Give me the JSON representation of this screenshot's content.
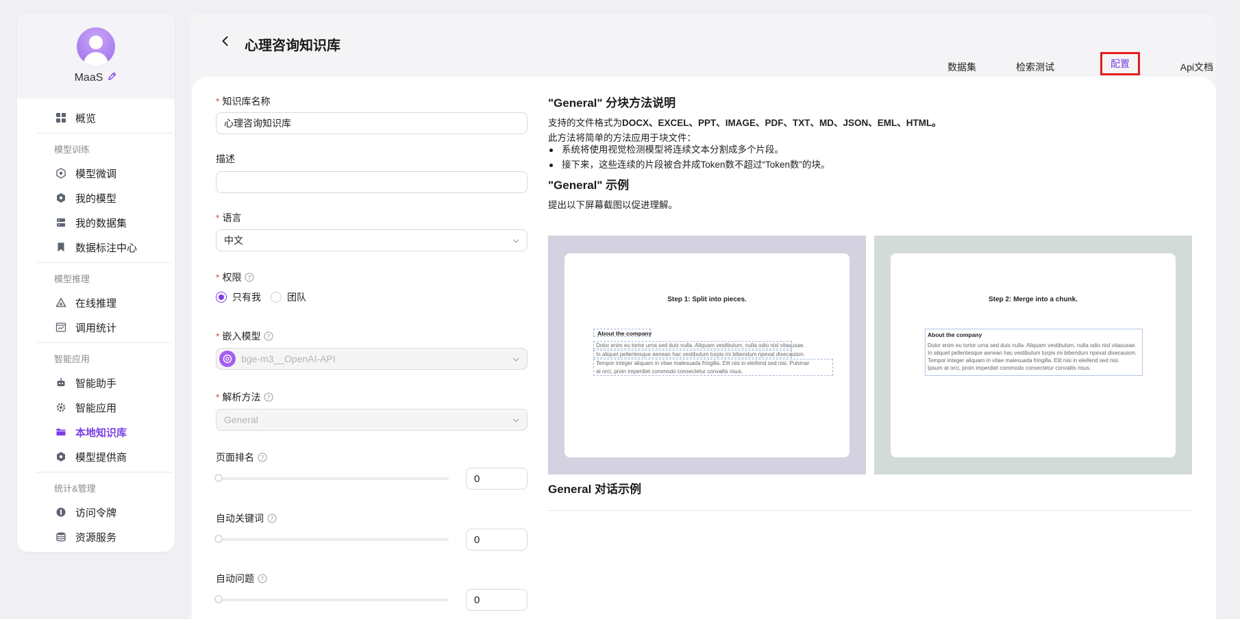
{
  "user": {
    "name": "MaaS"
  },
  "sidebar": {
    "top_item": {
      "label": "概览",
      "icon": "grid-icon"
    },
    "groups": [
      {
        "title": "模型训练",
        "items": [
          {
            "label": "模型微调",
            "icon": "gear-hex-icon"
          },
          {
            "label": "我的模型",
            "icon": "hex-icon"
          },
          {
            "label": "我的数据集",
            "icon": "server-icon"
          },
          {
            "label": "数据标注中心",
            "icon": "bookmark-icon"
          }
        ]
      },
      {
        "title": "模型推理",
        "items": [
          {
            "label": "在线推理",
            "icon": "triangle-icon"
          },
          {
            "label": "调用统计",
            "icon": "chart-window-icon"
          }
        ]
      },
      {
        "title": "智能应用",
        "items": [
          {
            "label": "智能助手",
            "icon": "robot-icon"
          },
          {
            "label": "智能应用",
            "icon": "gear-icon"
          },
          {
            "label": "本地知识库",
            "icon": "folder-icon",
            "active": true
          },
          {
            "label": "模型提供商",
            "icon": "hex-icon"
          }
        ]
      },
      {
        "title": "统计&管理",
        "items": [
          {
            "label": "访问令牌",
            "icon": "token-icon"
          },
          {
            "label": "资源服务",
            "icon": "database-icon"
          }
        ]
      }
    ]
  },
  "header": {
    "title": "心理咨询知识库",
    "tabs": [
      "数据集",
      "检索测试",
      "配置",
      "Api文档"
    ],
    "active_tab": "配置"
  },
  "form": {
    "name_label": "知识库名称",
    "name_value": "心理咨询知识库",
    "desc_label": "描述",
    "desc_value": "",
    "lang_label": "语言",
    "lang_value": "中文",
    "perm_label": "权限",
    "perm_options": [
      "只有我",
      "团队"
    ],
    "perm_selected": "只有我",
    "embed_label": "嵌入模型",
    "embed_value": "bge-m3__OpenAI-API",
    "parse_label": "解析方法",
    "parse_value": "General",
    "page_rank_label": "页面排名",
    "page_rank_value": "0",
    "auto_kw_label": "自动关键词",
    "auto_kw_value": "0",
    "auto_q_label": "自动问题",
    "auto_q_value": "0"
  },
  "doc": {
    "title": "\"General\" 分块方法说明",
    "formats_prefix": "支持的文件格式为",
    "formats": "DOCX、EXCEL、PPT、IMAGE、PDF、TXT、MD、JSON、EML、HTML。",
    "intro": "此方法将简单的方法应用于块文件：",
    "bullets": [
      "系统将使用视觉检测模型将连续文本分割成多个片段。",
      "接下来，这些连续的片段被合并成Token数不超过“Token数”的块。"
    ],
    "example_title": "\"General\" 示例",
    "example_desc": "提出以下屏幕截图以促进理解。",
    "dialog_title": "General 对话示例",
    "panel1": {
      "title": "Step 1: Split into pieces.",
      "heading": "About the company",
      "lines": [
        "Dolor enim eu tortor urna sed duis nulla. Aliquam vestibulum, nulla odio nisl vitasusae.",
        "In aliquet pellentesque aenean hac vestibulum turpis mi bibendum npexat dixecauism.",
        "Tempor integer aliquam in vitae malesuada fringilla. Elit nisi in eleifend sed nisi. Pulvinar",
        "at orci, proin imperdiet commodo consectetur convallis risus."
      ]
    },
    "panel2": {
      "title": "Step 2: Merge into a chunk.",
      "heading": "About the company",
      "lines": [
        "Dolor enim eu tortor urna sed duis nulla. Aliquam vestibulum, nulla odio nisl vitasusae.",
        "In aliquet pellentesque aenean hac vestibulum turpis mi bibendum npexat dixecauism.",
        "Tempor integer aliquam in vitae malesuada fringilla. Elit nisi in eleifend sed nisi.",
        "Ipsum at orci, proin imperdiet commodo consectetur convallis risus."
      ]
    },
    "colors": {
      "panel1_bg": "#d4d1e0",
      "panel2_bg": "#d2dbd8",
      "accent": "#7a3fe4",
      "highlight": "#e31b1b"
    }
  }
}
